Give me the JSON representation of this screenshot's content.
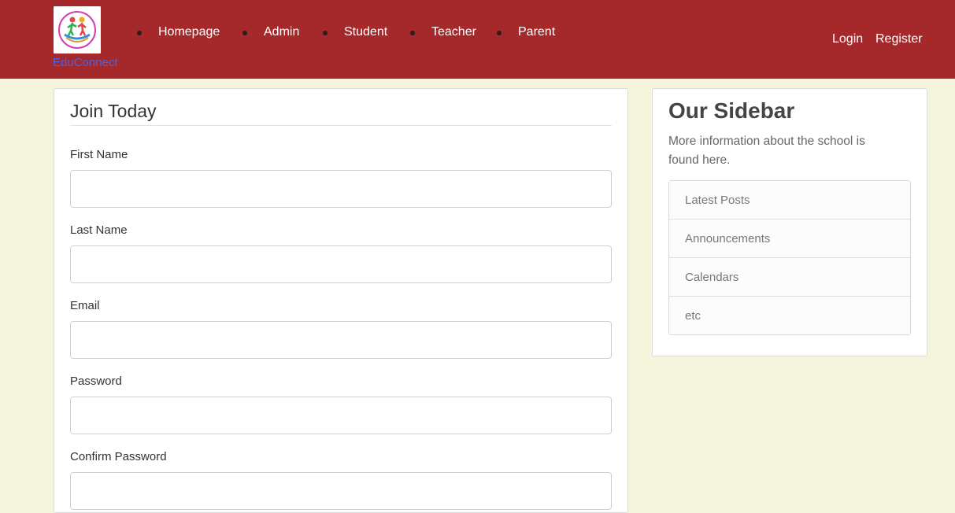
{
  "brand": {
    "name": "EduConnect",
    "logo_icon": "school-logo-icon"
  },
  "nav": {
    "items": [
      {
        "label": "Homepage"
      },
      {
        "label": "Admin"
      },
      {
        "label": "Student"
      },
      {
        "label": "Teacher"
      },
      {
        "label": "Parent"
      }
    ],
    "login": "Login",
    "register": "Register"
  },
  "form": {
    "title": "Join Today",
    "fields": [
      {
        "label": "First Name",
        "value": ""
      },
      {
        "label": "Last Name",
        "value": ""
      },
      {
        "label": "Email",
        "value": ""
      },
      {
        "label": "Password",
        "value": ""
      },
      {
        "label": "Confirm Password",
        "value": ""
      }
    ]
  },
  "sidebar": {
    "title": "Our Sidebar",
    "text": "More information about the school is found here.",
    "items": [
      {
        "label": "Latest Posts"
      },
      {
        "label": "Announcements"
      },
      {
        "label": "Calendars"
      },
      {
        "label": "etc"
      }
    ]
  },
  "colors": {
    "navbar": "#a5292a",
    "page_bg": "#f5f4dc",
    "brand_text": "#4b63e6"
  }
}
